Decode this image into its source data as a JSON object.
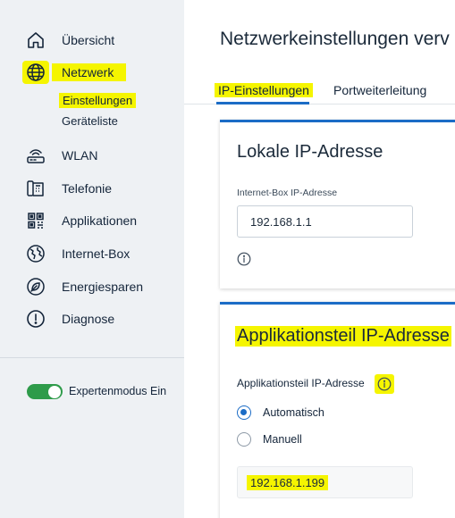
{
  "sidebar": {
    "items": [
      {
        "label": "Übersicht",
        "icon": "home-icon"
      },
      {
        "label": "Netzwerk",
        "icon": "globe-icon"
      },
      {
        "label": "WLAN",
        "icon": "router-icon"
      },
      {
        "label": "Telefonie",
        "icon": "phone-icon"
      },
      {
        "label": "Applikationen",
        "icon": "apps-icon"
      },
      {
        "label": "Internet-Box",
        "icon": "internet-box-icon"
      },
      {
        "label": "Energiesparen",
        "icon": "leaf-icon"
      },
      {
        "label": "Diagnose",
        "icon": "alert-icon"
      }
    ],
    "subitems": [
      {
        "label": "Einstellungen"
      },
      {
        "label": "Geräteliste"
      }
    ],
    "expert_toggle": {
      "label": "Expertenmodus Ein",
      "on": true
    }
  },
  "main": {
    "title": "Netzwerkeinstellungen verv",
    "tabs": [
      {
        "label": "IP-Einstellungen",
        "active": true
      },
      {
        "label": "Portweiterleitung",
        "active": false
      }
    ],
    "card_local": {
      "title": "Lokale IP-Adresse",
      "field_label": "Internet-Box IP-Adresse",
      "value": "192.168.1.1"
    },
    "card_app": {
      "title": "Applikationsteil IP-Adresse",
      "field_label": "Applikationsteil IP-Adresse",
      "options": [
        {
          "label": "Automatisch",
          "selected": true
        },
        {
          "label": "Manuell",
          "selected": false
        }
      ],
      "value": "192.168.1.199"
    }
  },
  "colors": {
    "accent": "#1b6cc6",
    "highlight": "#f5f500",
    "toggle_on": "#2e9b4a",
    "sidebar_bg": "#eef1f4"
  }
}
